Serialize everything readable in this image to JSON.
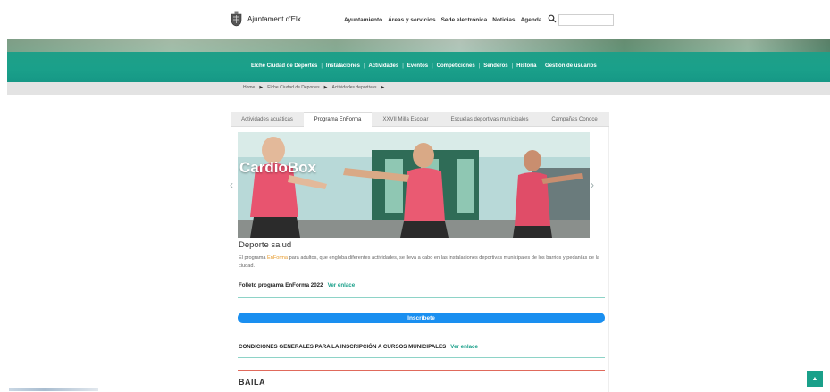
{
  "header": {
    "brand": "Ajuntament d'Elx",
    "nav": [
      "Ayuntamiento",
      "Áreas y servicios",
      "Sede electrónica",
      "Noticias",
      "Agenda"
    ],
    "search": {
      "value": "",
      "placeholder": ""
    }
  },
  "banner_nav": [
    "Elche Ciudad de Deportes",
    "Instalaciones",
    "Actividades",
    "Eventos",
    "Competiciones",
    "Senderos",
    "Historia",
    "Gestión de usuarios"
  ],
  "breadcrumb": [
    "Home",
    "Elche Ciudad de Deportes",
    "Actividades deportivas"
  ],
  "tabs": [
    {
      "label": "Actividades acuáticas",
      "active": false
    },
    {
      "label": "Programa EnForma",
      "active": true
    },
    {
      "label": "XXVII Milla Escolar",
      "active": false
    },
    {
      "label": "Escuelas deportivas municipales",
      "active": false
    },
    {
      "label": "Campañas Conoce",
      "active": false
    }
  ],
  "slide": {
    "title": "CardioBox"
  },
  "section": {
    "title": "Deporte salud",
    "desc_before": "El programa ",
    "desc_em": "EnForma",
    "desc_after": " para adultos, que engloba diferentes actividades, se lleva a cabo en las instalaciones deportivas municipales de los barrios y pedanías de la ciudad."
  },
  "folleto": {
    "label": "Folleto programa EnForma 2022",
    "link": "Ver enlace"
  },
  "cta": {
    "label": "Inscríbete"
  },
  "conditions": {
    "label": "CONDICIONES GENERALES PARA LA INSCRIPCIÓN A CURSOS MUNICIPALES",
    "link": "Ver enlace"
  },
  "next_section": {
    "title": "BAILA"
  },
  "colors": {
    "teal": "#1aa08a",
    "button_blue": "#1a8ff0",
    "accent_orange": "#e79b2d",
    "rule_red": "#e06a5c"
  },
  "icons": {
    "search": "search-icon",
    "crest": "crest-icon",
    "prev": "chevron-left-icon",
    "next": "chevron-right-icon",
    "scroll_top": "chevron-up-icon"
  }
}
